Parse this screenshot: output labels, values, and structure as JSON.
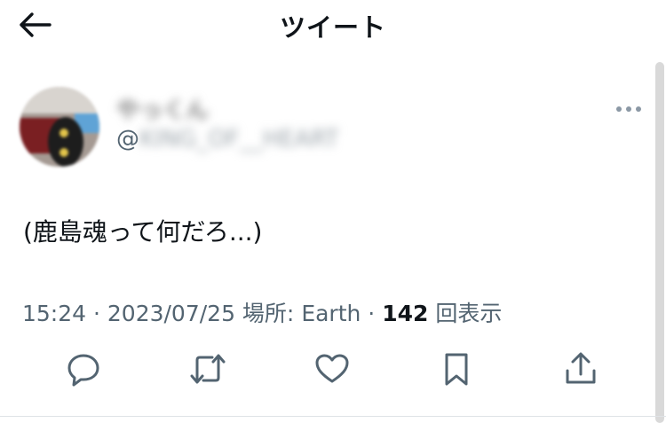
{
  "header": {
    "title": "ツイート"
  },
  "author": {
    "display_name": "やっくん",
    "handle_prefix": "@",
    "handle_blurred": "KING_OF__HEART"
  },
  "tweet": {
    "text": "(鹿島魂って何だろ...)"
  },
  "meta": {
    "time": "15:24",
    "sep1": " · ",
    "date": "2023/07/25",
    "location_label": " 場所: ",
    "location": "Earth",
    "sep2": " · ",
    "views_count": "142",
    "views_label": " 回表示"
  },
  "icons": {
    "back": "arrow-left-icon",
    "more": "more-dots-icon",
    "reply": "reply-icon",
    "retweet": "retweet-icon",
    "like": "heart-icon",
    "bookmark": "bookmark-icon",
    "share": "share-icon"
  },
  "colors": {
    "text": "#0f1419",
    "secondary": "#536471",
    "divider": "#dfe3e6"
  }
}
